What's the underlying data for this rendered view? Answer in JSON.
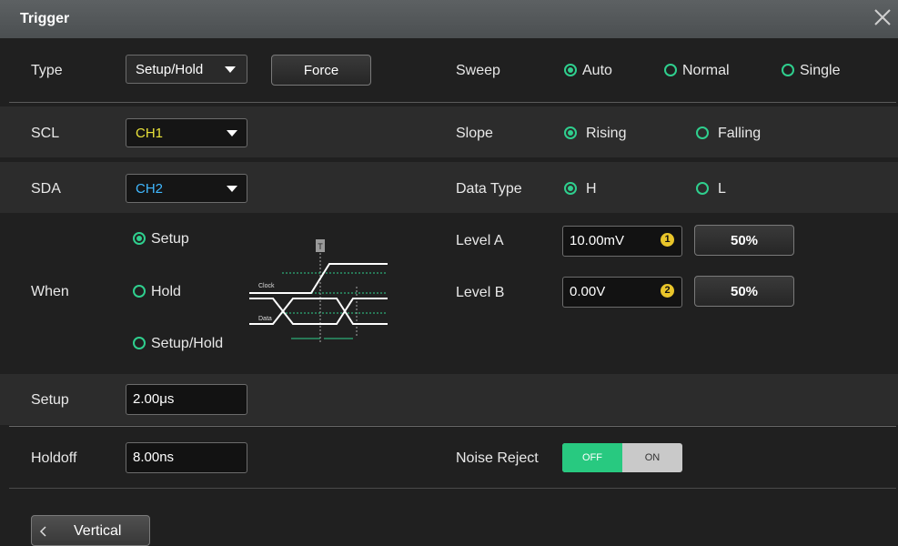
{
  "window": {
    "title": "Trigger"
  },
  "type": {
    "label": "Type",
    "value": "Setup/Hold",
    "force_label": "Force"
  },
  "sweep": {
    "label": "Sweep",
    "options": [
      "Auto",
      "Normal",
      "Single"
    ],
    "selected": "Auto"
  },
  "scl": {
    "label": "SCL",
    "value": "CH1",
    "color": "#e9e23a"
  },
  "slope": {
    "label": "Slope",
    "options": [
      "Rising",
      "Falling"
    ],
    "selected": "Rising"
  },
  "sda": {
    "label": "SDA",
    "value": "CH2",
    "color": "#40b8ff"
  },
  "data_type": {
    "label": "Data Type",
    "options": [
      "H",
      "L"
    ],
    "selected": "H"
  },
  "when": {
    "label": "When",
    "options": [
      "Setup",
      "Hold",
      "Setup/Hold"
    ],
    "selected": "Setup"
  },
  "diagram": {
    "clock_label": "Clock",
    "data_label": "Data",
    "marker": "T"
  },
  "level_a": {
    "label": "Level A",
    "value": "10.00mV",
    "badge": "1",
    "button": "50%"
  },
  "level_b": {
    "label": "Level B",
    "value": "0.00V",
    "badge": "2",
    "button": "50%"
  },
  "setup": {
    "label": "Setup",
    "value": "2.00μs"
  },
  "holdoff": {
    "label": "Holdoff",
    "value": "8.00ns"
  },
  "noise_reject": {
    "label": "Noise Reject",
    "off": "OFF",
    "on": "ON",
    "state": "OFF"
  },
  "nav": {
    "back_label": "Vertical"
  },
  "colors": {
    "accent": "#2fcf8e",
    "badge": "#e9c52a"
  }
}
